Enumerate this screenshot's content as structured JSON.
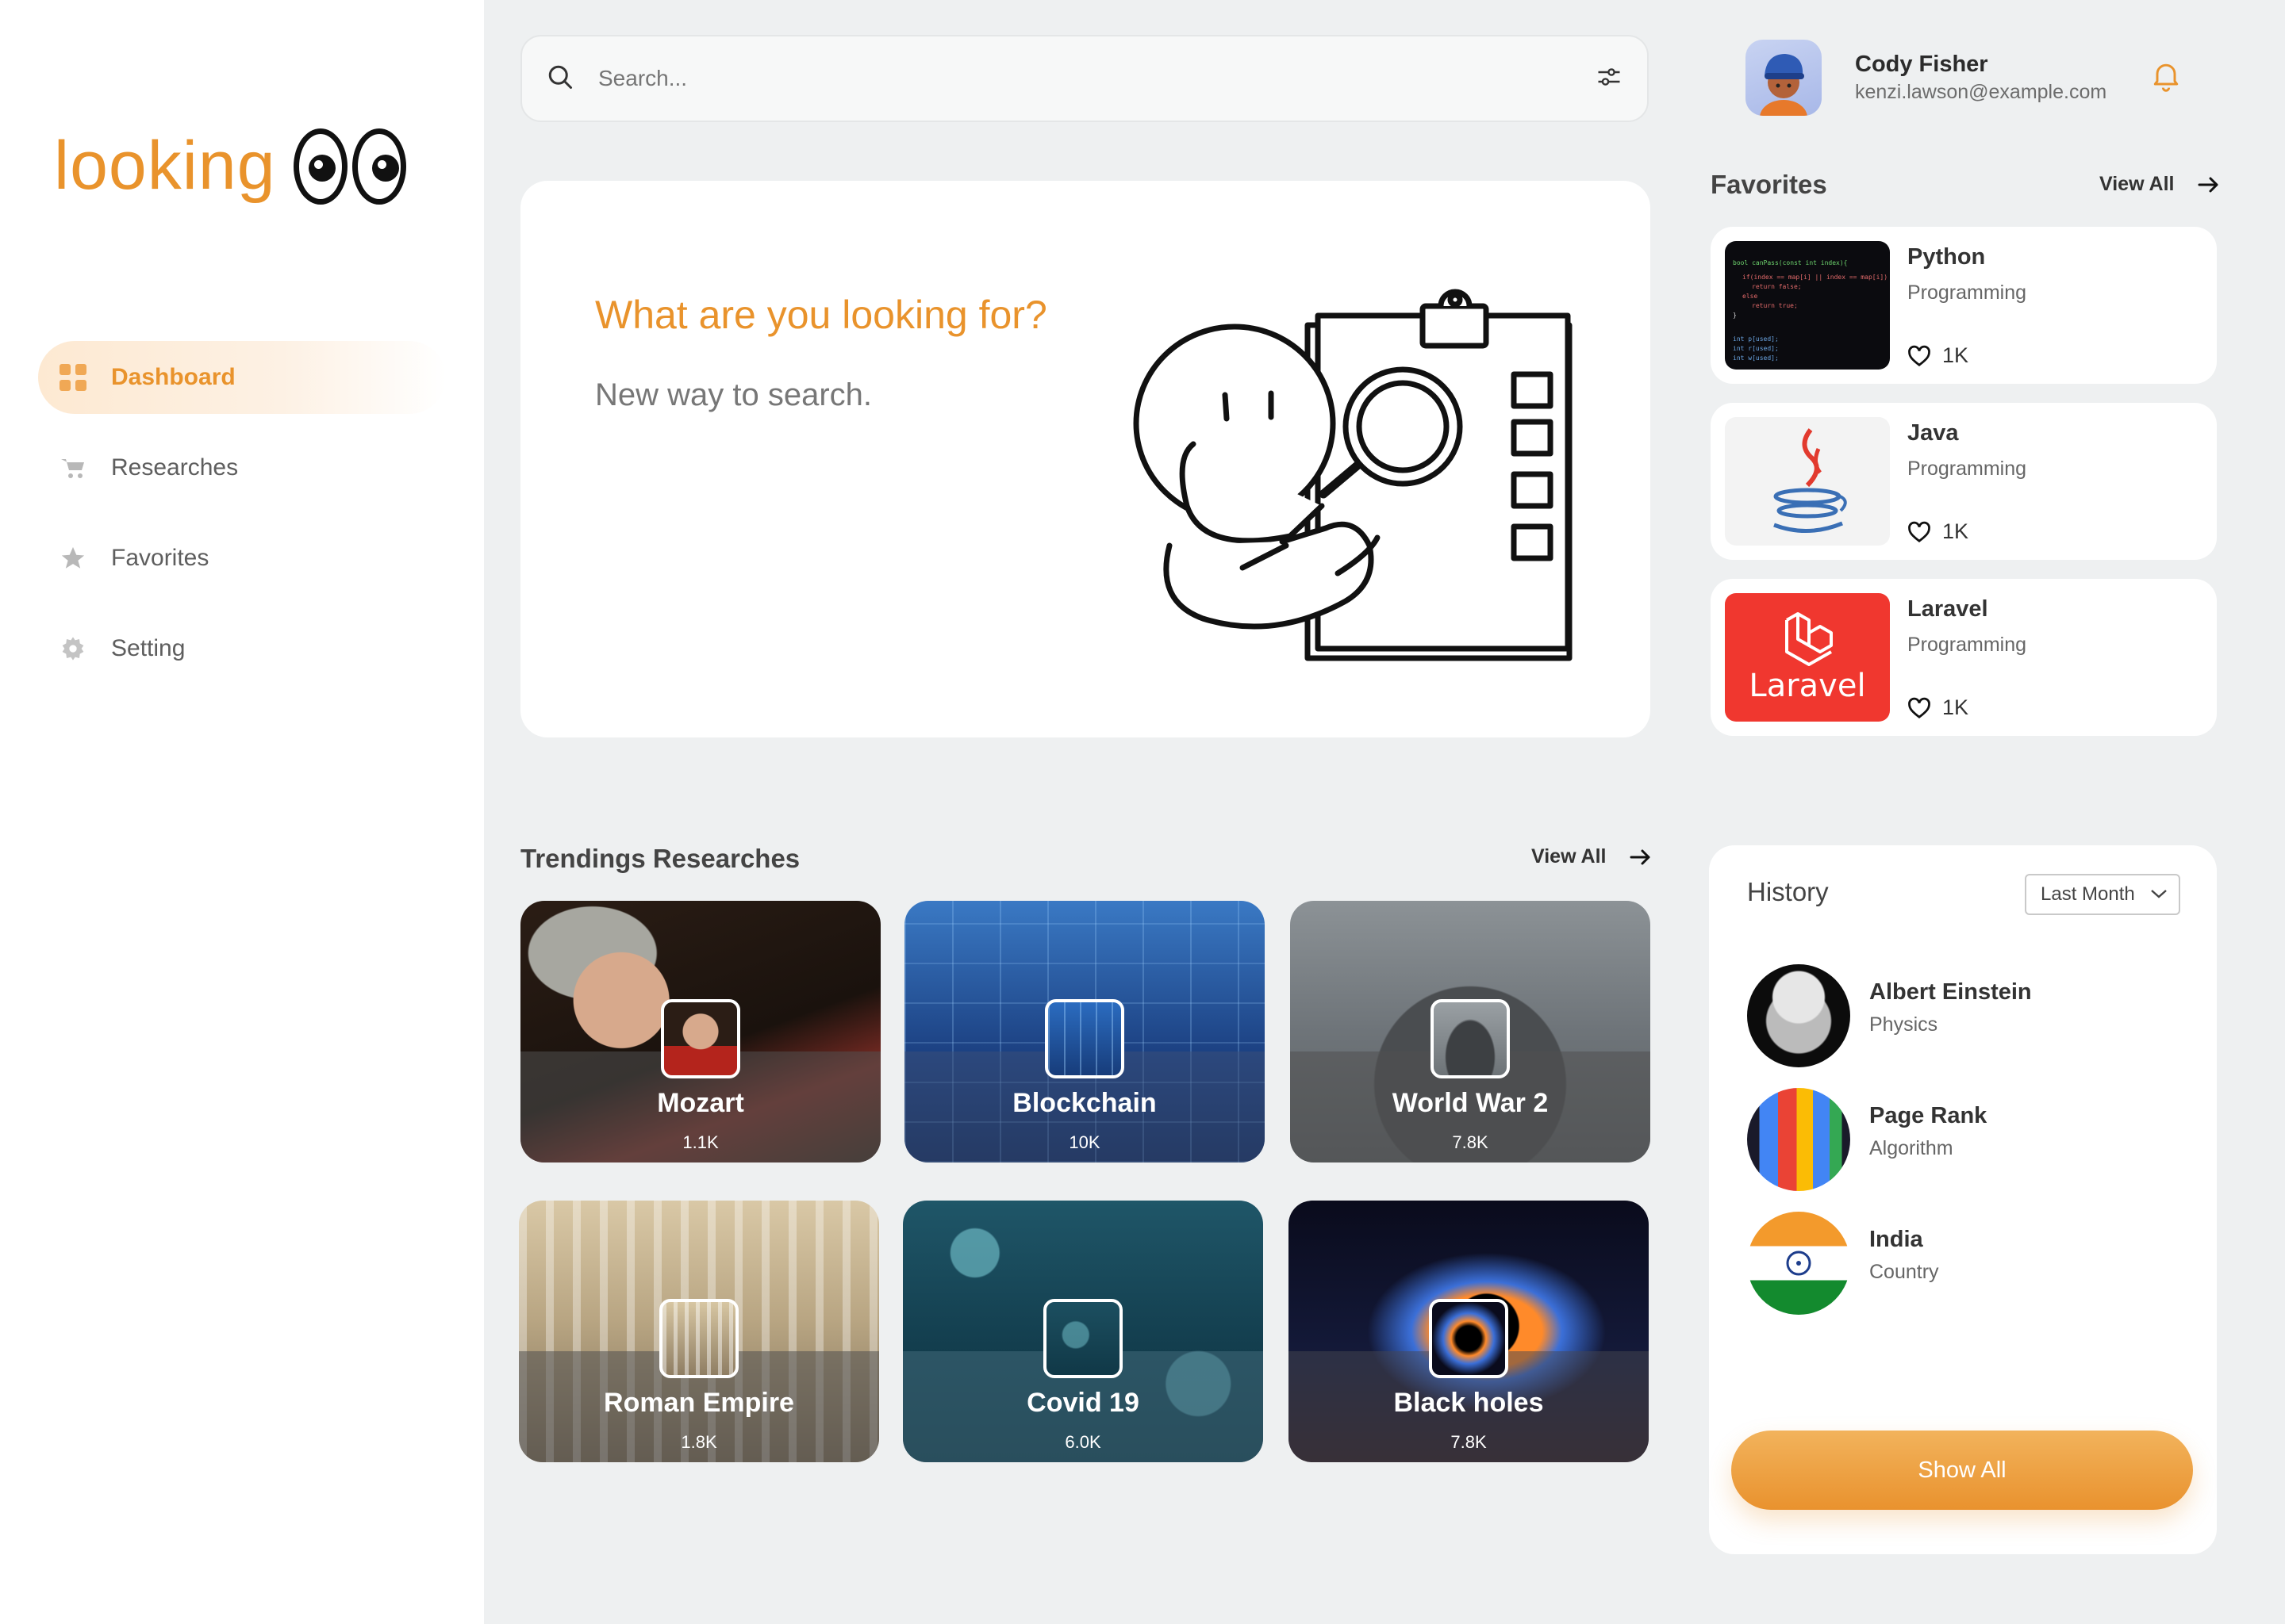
{
  "brand": {
    "name": "looking"
  },
  "sidebar": {
    "items": [
      {
        "label": "Dashboard",
        "icon": "dashboard-icon",
        "active": true
      },
      {
        "label": "Researches",
        "icon": "cart-icon"
      },
      {
        "label": "Favorites",
        "icon": "star-icon"
      },
      {
        "label": "Setting",
        "icon": "gear-icon"
      }
    ]
  },
  "search": {
    "placeholder": "Search..."
  },
  "user": {
    "name": "Cody Fisher",
    "email": "kenzi.lawson@example.com"
  },
  "hero": {
    "title": "What are you looking for?",
    "subtitle": "New way to search."
  },
  "favorites": {
    "title": "Favorites",
    "view_all": "View All",
    "items": [
      {
        "title": "Python",
        "category": "Programming",
        "likes": "1K"
      },
      {
        "title": "Java",
        "category": "Programming",
        "likes": "1K"
      },
      {
        "title": "Laravel",
        "category": "Programming",
        "likes": "1K",
        "logo_text": "Laravel"
      }
    ]
  },
  "trending": {
    "title": "Trendings Researches",
    "view_all": "View All",
    "items": [
      {
        "name": "Mozart",
        "count": "1.1K"
      },
      {
        "name": "Blockchain",
        "count": "10K"
      },
      {
        "name": "World War 2",
        "count": "7.8K"
      },
      {
        "name": "Roman Empire",
        "count": "1.8K"
      },
      {
        "name": "Covid 19",
        "count": "6.0K"
      },
      {
        "name": "Black holes",
        "count": "7.8K"
      }
    ]
  },
  "history": {
    "title": "History",
    "filter": "Last Month",
    "items": [
      {
        "name": "Albert Einstein",
        "category": "Physics"
      },
      {
        "name": "Page Rank",
        "category": "Algorithm"
      },
      {
        "name": "India",
        "category": "Country"
      }
    ],
    "show_all": "Show All"
  },
  "colors": {
    "accent": "#e9932c",
    "background": "#eef0f1",
    "card": "#ffffff"
  }
}
